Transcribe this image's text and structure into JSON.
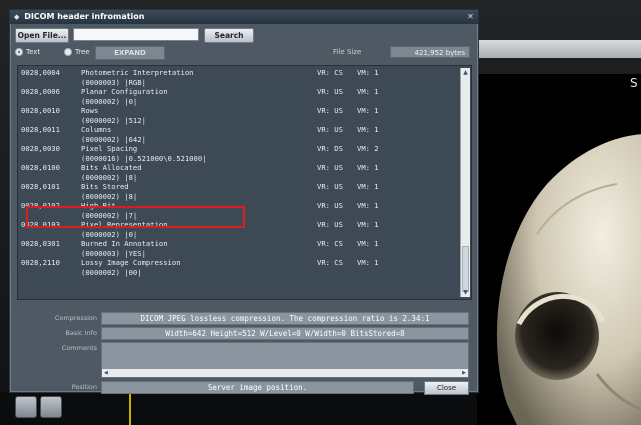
{
  "dialog": {
    "title": "DICOM header infromation",
    "open_file_label": "Open File...",
    "search_value": "",
    "search_label": "Search",
    "view_text_label": "Text",
    "view_tree_label": "Tree",
    "expand_label": "EXPAND",
    "file_size_label": "File Size",
    "file_size_value": "421,952 bytes"
  },
  "tags": [
    {
      "id": "0028,0004",
      "name": "Photometric Interpretation",
      "value": "(0000003) |RGB|",
      "vr": "VR: CS",
      "vm": "VM: 1"
    },
    {
      "id": "0028,0006",
      "name": "Planar Configuration",
      "value": "(0000002) |0|",
      "vr": "VR: US",
      "vm": "VM: 1"
    },
    {
      "id": "0028,0010",
      "name": "Rows",
      "value": "(0000002) |512|",
      "vr": "VR: US",
      "vm": "VM: 1"
    },
    {
      "id": "0028,0011",
      "name": "Columns",
      "value": "(0000002) |642|",
      "vr": "VR: US",
      "vm": "VM: 1"
    },
    {
      "id": "0028,0030",
      "name": "Pixel Spacing",
      "value": "(0000016) |0.521000\\0.521000|",
      "vr": "VR: DS",
      "vm": "VM: 2"
    },
    {
      "id": "0028,0100",
      "name": "Bits Allocated",
      "value": "(0000002) |8|",
      "vr": "VR: US",
      "vm": "VM: 1"
    },
    {
      "id": "0028,0101",
      "name": "Bits Stored",
      "value": "(0000002) |8|",
      "vr": "VR: US",
      "vm": "VM: 1"
    },
    {
      "id": "0028,0102",
      "name": "High Bit",
      "value": "(0000002) |7|",
      "vr": "VR: US",
      "vm": "VM: 1"
    },
    {
      "id": "0028,0103",
      "name": "Pixel Representation",
      "value": "(0000002) |0|",
      "vr": "VR: US",
      "vm": "VM: 1"
    },
    {
      "id": "0028,0301",
      "name": "Burned In Annotation",
      "value": "(0000003) |YES|",
      "vr": "VR: CS",
      "vm": "VM: 1"
    },
    {
      "id": "0028,2110",
      "name": "Lossy Image Compression",
      "value": "(0000002) |00|",
      "vr": "VR: CS",
      "vm": "VM: 1"
    }
  ],
  "info": {
    "compression_label": "Compression",
    "compression_value": "DICOM JPEG lossless compression. The compression ratio is 2.34:1",
    "basic_info_label": "Basic Info",
    "basic_info_value": "Width=642  Height=512  W/Level=0  W/Width=0  BitsStored=8",
    "comments_label": "Comments",
    "comments_value": "",
    "position_label": "Position",
    "position_value": "Server image position.",
    "close_label": "Close"
  },
  "background": {
    "viewer_letter": "S"
  },
  "colors": {
    "highlight": "#e11c1c",
    "dialog_bg": "#4f5964",
    "list_bg": "#3d4955"
  }
}
